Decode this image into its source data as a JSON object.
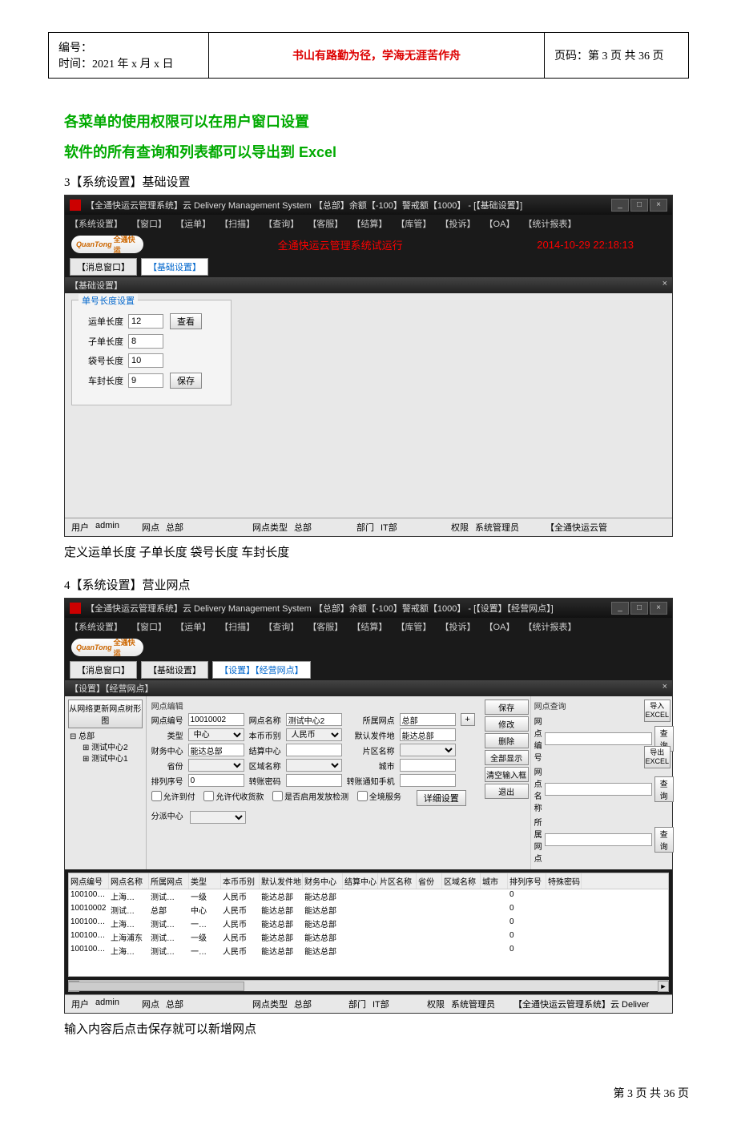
{
  "header": {
    "id_label": "编号：",
    "date_label": "时间：2021 年 x 月 x 日",
    "motto": "书山有路勤为径，学海无涯苦作舟",
    "page_label": "页码：第 3 页 共 36 页"
  },
  "green1": "各菜单的使用权限可以在用户窗口设置",
  "green2": "软件的所有查询和列表都可以导出到 Excel",
  "sec3_label": "3【系统设置】基础设置",
  "sec4_label": "4【系统设置】营业网点",
  "caption1": "定义运单长度  子单长度  袋号长度  车封长度",
  "caption2": "输入内容后点击保存就可以新增网点",
  "footer": "第  3  页  共  36  页",
  "shot1": {
    "title": "【全通快运云管理系统】云  Delivery Management System 【总部】余额【-100】警戒额【1000】 - [【基础设置】]",
    "menus": [
      "【系统设置】",
      "【窗口】",
      "【运单】",
      "【扫描】",
      "【查询】",
      "【客服】",
      "【结算】",
      "【库管】",
      "【投诉】",
      "【OA】",
      "【统计报表】"
    ],
    "logo": "QuanTong",
    "logo_cn": "全通快运",
    "banner_center": "全通快运云管理系统试运行",
    "banner_right": "2014-10-29 22:18:13",
    "tab_msg": "【消息窗口】",
    "tab_base": "【基础设置】",
    "subtitle": "【基础设置】",
    "group_legend": "单号长度设置",
    "rows": [
      {
        "label": "运单长度",
        "val": "12",
        "btn": "查看"
      },
      {
        "label": "子单长度",
        "val": "8",
        "btn": ""
      },
      {
        "label": "袋号长度",
        "val": "10",
        "btn": ""
      },
      {
        "label": "车封长度",
        "val": "9",
        "btn": "保存"
      }
    ],
    "status": {
      "user_l": "用户",
      "user_v": "admin",
      "node_l": "网点",
      "node_v": "总部",
      "type_l": "网点类型",
      "type_v": "总部",
      "dept_l": "部门",
      "dept_v": "IT部",
      "role_l": "权限",
      "role_v": "系统管理员",
      "tail": "【全通快运云管"
    }
  },
  "shot2": {
    "title": "【全通快运云管理系统】云  Delivery Management System 【总部】余额【-100】警戒额【1000】 - [【设置】【经营网点】]",
    "menus": [
      "【系统设置】",
      "【窗口】",
      "【运单】",
      "【扫描】",
      "【查询】",
      "【客服】",
      "【结算】",
      "【库管】",
      "【投诉】",
      "【OA】",
      "【统计报表】"
    ],
    "tab_msg": "【消息窗口】",
    "tab_base": "【基础设置】",
    "tab_set": "【设置】【经营网点】",
    "subtitle": "【设置】【经营网点】",
    "tree_btn": "从网络更新网点树形图",
    "tree_root": "总部",
    "tree_c1": "测试中心2",
    "tree_c2": "测试中心1",
    "edit_title": "网点编辑",
    "labels": {
      "code": "网点编号",
      "name": "网点名称",
      "belong": "所属网点",
      "type": "类型",
      "curr": "本币币别",
      "defsend": "默认发件地",
      "fin": "财务中心",
      "settle": "结算中心",
      "area": "片区名称",
      "prov": "省份",
      "region": "区域名称",
      "city": "城市",
      "sort": "排列序号",
      "tpwd": "转账密码",
      "tphone": "转账通知手机",
      "allow_pay": "允许到付",
      "allow_cod": "允许代收货款",
      "enable_rel": "是否启用发放检测",
      "full_serv": "全境服务",
      "detail_btn": "详细设置",
      "disp": "分派中心"
    },
    "vals": {
      "code": "10010002",
      "name": "测试中心2",
      "belong": "总部",
      "type": "中心",
      "curr": "人民币",
      "defsend": "能达总部",
      "fin": "能达总部",
      "settle": "",
      "area": "",
      "prov": "",
      "region": "",
      "city": "",
      "sort": "0",
      "tpwd": "",
      "tphone": ""
    },
    "actions": [
      "保存",
      "修改",
      "删除",
      "全部显示",
      "清空输入框",
      "退出"
    ],
    "query_title": "网点查询",
    "query": {
      "code_l": "网点编号",
      "name_l": "网点名称",
      "belong_l": "所属网点",
      "btn": "查询"
    },
    "excel_import": "导入\nEXCEL",
    "excel_export": "导出\nEXCEL",
    "grid_head": [
      "网点编号",
      "网点名称",
      "所属网点",
      "类型",
      "本币币别",
      "默认发件地",
      "财务中心",
      "结算中心",
      "片区名称",
      "省份",
      "区域名称",
      "城市",
      "排列序号",
      "特殊密码"
    ],
    "grid_rows": [
      [
        "100100…",
        "上海…",
        "测试…",
        "一级",
        "人民币",
        "能达总部",
        "能达总部",
        "",
        "",
        "",
        "",
        "",
        "0",
        ""
      ],
      [
        "10010002",
        "测试…",
        "总部",
        "中心",
        "人民币",
        "能达总部",
        "能达总部",
        "",
        "",
        "",
        "",
        "",
        "0",
        ""
      ],
      [
        "100100…",
        "上海…",
        "测试…",
        "一…",
        "人民币",
        "能达总部",
        "能达总部",
        "",
        "",
        "",
        "",
        "",
        "0",
        ""
      ],
      [
        "100100…",
        "上海浦东",
        "测试…",
        "一级",
        "人民币",
        "能达总部",
        "能达总部",
        "",
        "",
        "",
        "",
        "",
        "0",
        ""
      ],
      [
        "100100…",
        "上海…",
        "测试…",
        "一…",
        "人民币",
        "能达总部",
        "能达总部",
        "",
        "",
        "",
        "",
        "",
        "0",
        ""
      ]
    ],
    "status": {
      "user_l": "用户",
      "user_v": "admin",
      "node_l": "网点",
      "node_v": "总部",
      "type_l": "网点类型",
      "type_v": "总部",
      "dept_l": "部门",
      "dept_v": "IT部",
      "role_l": "权限",
      "role_v": "系统管理员",
      "tail": "【全通快运云管理系统】云 Deliver"
    }
  }
}
